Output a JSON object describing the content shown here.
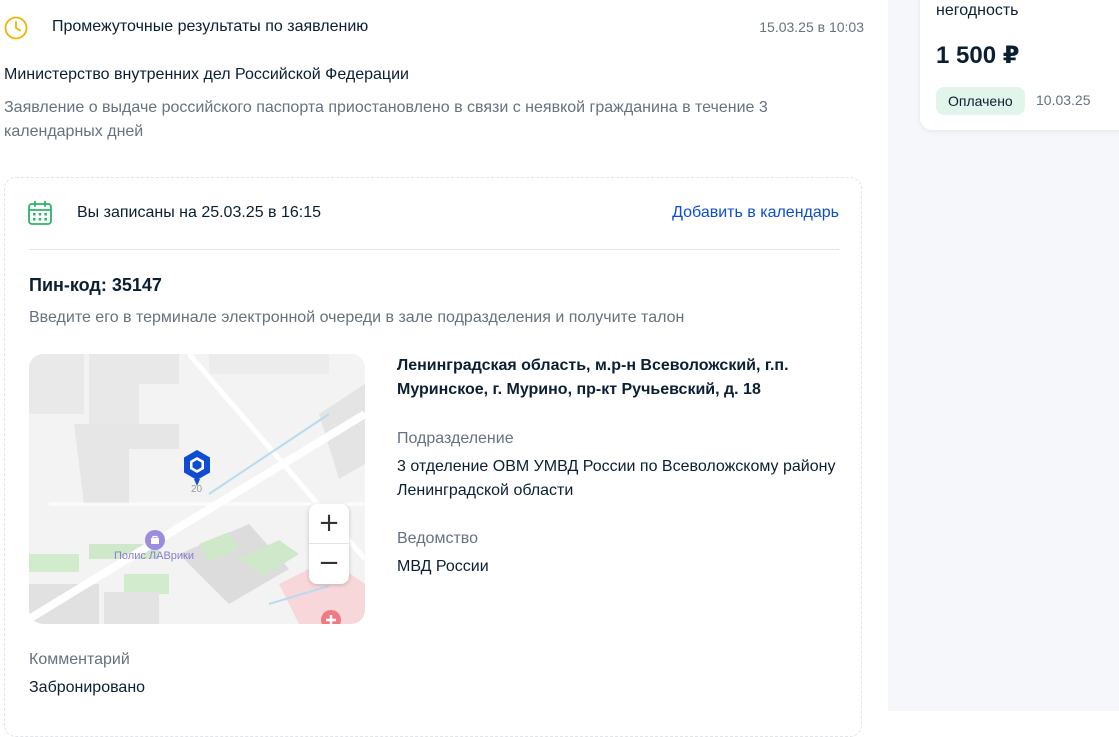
{
  "status": {
    "title": "Промежуточные результаты по заявлению",
    "time": "15.03.25 в 10:03",
    "icon": "clock-icon"
  },
  "organization": "Министерство внутренних дел Российской Федерации",
  "description": "Заявление о выдаче российского паспорта приостановлено в связи с неявкой гражданина в течение 3 календарных дней",
  "appointment": {
    "text": "Вы записаны на 25.03.25 в 16:15",
    "add_calendar_label": "Добавить в календарь",
    "icon": "calendar-icon"
  },
  "pin": {
    "label": "Пин-код: 35147",
    "hint": "Введите его в терминале электронной очереди в зале подразделения и получите талон"
  },
  "map": {
    "building_number": "20",
    "poi_label": "Полис ЛАВрики",
    "zoom_in": "+",
    "zoom_out": "−"
  },
  "address": "Ленинградская область, м.р-н Всеволожский, г.п. Муринское, г. Мурино, пр-кт Ручьевский, д. 18",
  "department": {
    "label": "Подразделение",
    "value": "3 отделение ОВМ УМВД России по Всеволожскому району Ленинградской области"
  },
  "agency": {
    "label": "Ведомство",
    "value": "МВД России"
  },
  "comment": {
    "label": "Комментарий",
    "value": "Забронировано"
  },
  "payment": {
    "title": "негодность",
    "amount": "1 500 ₽",
    "status": "Оплачено",
    "date": "10.03.25"
  },
  "colors": {
    "link": "#0d4cd3",
    "clock": "#f1b400",
    "calendar": "#2db36a",
    "paid_badge_bg": "#e2f5ea",
    "marker": "#0d4cd3"
  }
}
